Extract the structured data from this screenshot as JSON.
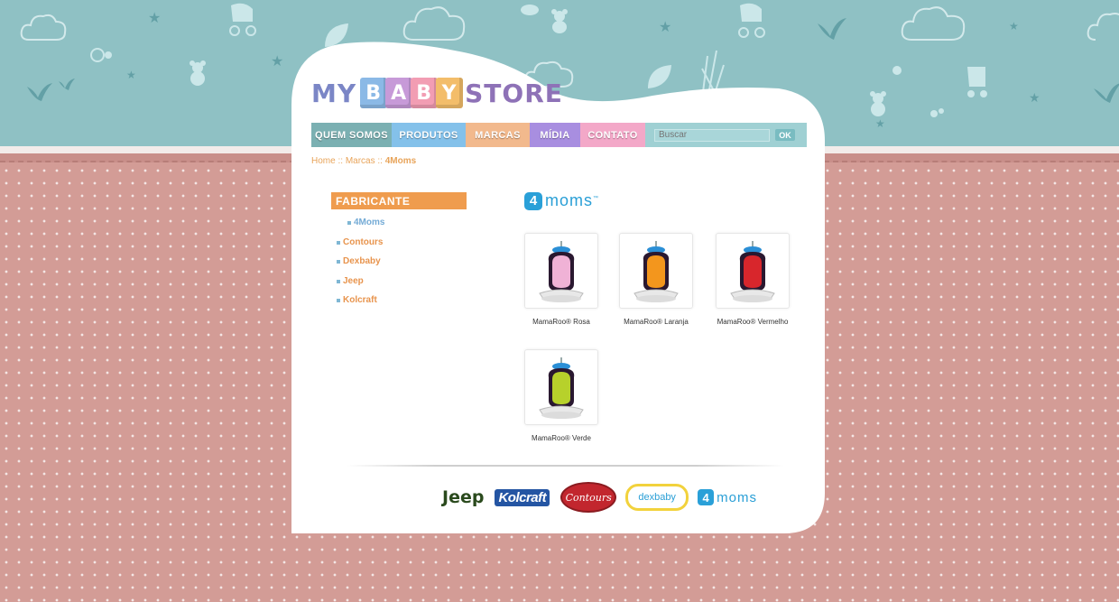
{
  "header": {
    "logo": {
      "my": "MY",
      "blocks": [
        "B",
        "A",
        "B",
        "Y"
      ],
      "store": "STORE"
    }
  },
  "nav": {
    "items": [
      {
        "label": "QUEM SOMOS",
        "color": "#7bb0b2"
      },
      {
        "label": "PRODUTOS",
        "color": "#84c1ea"
      },
      {
        "label": "MARCAS",
        "color": "#f2b98d"
      },
      {
        "label": "MÍDIA",
        "color": "#a88ee0"
      },
      {
        "label": "CONTATO",
        "color": "#f3a8c8"
      }
    ],
    "search": {
      "placeholder": "Buscar",
      "button": "OK"
    }
  },
  "breadcrumb": {
    "home": "Home",
    "sep": "::",
    "section": "Marcas",
    "current": "4Moms"
  },
  "sidebar": {
    "title": "FABRICANTE",
    "items": [
      {
        "label": "4Moms",
        "active": true
      },
      {
        "label": "Contours"
      },
      {
        "label": "Dexbaby"
      },
      {
        "label": "Jeep"
      },
      {
        "label": "Kolcraft"
      }
    ]
  },
  "brand": {
    "logo_badge": "4",
    "logo_word": "moms",
    "logo_tm": "™"
  },
  "products": [
    {
      "name": "MamaRoo® Rosa",
      "color": "#f0b2d6",
      "icon": "baby-swing-image"
    },
    {
      "name": "MamaRoo® Laranja",
      "color": "#f3961d",
      "icon": "baby-swing-image"
    },
    {
      "name": "MamaRoo® Vermelho",
      "color": "#d8262c",
      "icon": "baby-swing-image"
    },
    {
      "name": "MamaRoo® Verde",
      "color": "#b7d12b",
      "icon": "baby-swing-image"
    }
  ],
  "footer_brands": {
    "jeep": "Jeep",
    "kolcraft": "Kolcraft",
    "contours": "Contours",
    "dexbaby": "dexbaby",
    "moms_badge": "4",
    "moms_word": "moms"
  }
}
